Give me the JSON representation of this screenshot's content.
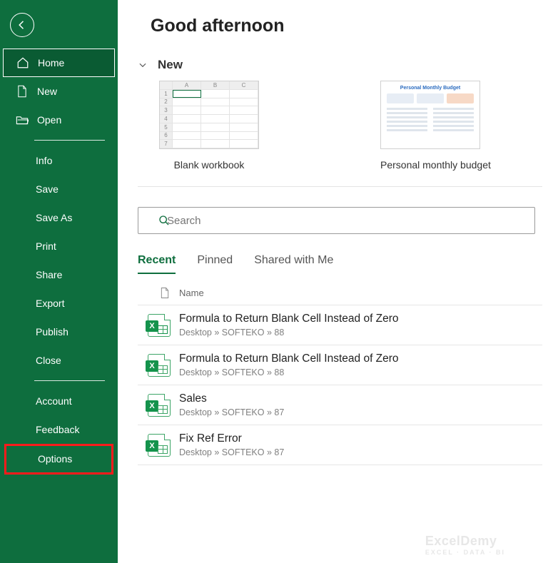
{
  "sidebar": {
    "home": "Home",
    "new": "New",
    "open": "Open",
    "info": "Info",
    "save": "Save",
    "save_as": "Save As",
    "print": "Print",
    "share": "Share",
    "export": "Export",
    "publish": "Publish",
    "close": "Close",
    "account": "Account",
    "feedback": "Feedback",
    "options": "Options"
  },
  "main": {
    "greeting": "Good afternoon",
    "new_section": "New",
    "templates": {
      "blank": "Blank workbook",
      "budget": "Personal monthly budget",
      "budget_thumb_title": "Personal Monthly Budget"
    },
    "search_placeholder": "Search",
    "tabs": {
      "recent": "Recent",
      "pinned": "Pinned",
      "shared": "Shared with Me"
    },
    "list_header_name": "Name",
    "files": [
      {
        "title": "Formula to Return Blank Cell Instead of Zero",
        "path": "Desktop » SOFTEKO » 88"
      },
      {
        "title": "Formula to Return Blank Cell Instead of Zero",
        "path": "Desktop » SOFTEKO » 88"
      },
      {
        "title": "Sales",
        "path": "Desktop » SOFTEKO » 87"
      },
      {
        "title": "Fix Ref Error",
        "path": "Desktop » SOFTEKO » 87"
      }
    ]
  },
  "watermark": {
    "brand": "ExcelDemy",
    "tag": "EXCEL · DATA · BI"
  }
}
